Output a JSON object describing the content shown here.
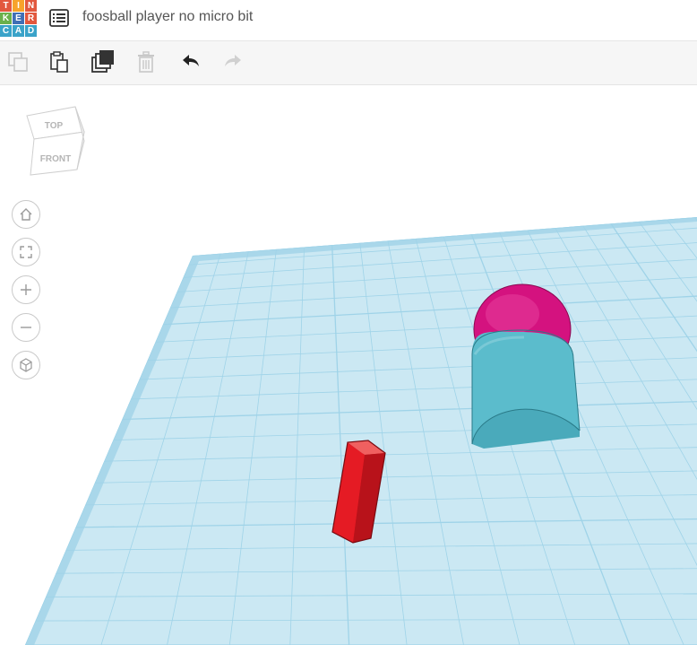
{
  "header": {
    "logo_letters": [
      "T",
      "I",
      "N",
      "K",
      "E",
      "R",
      "C",
      "A",
      "D"
    ],
    "logo_colors": [
      "#e2583e",
      "#f7a32b",
      "#e2583e",
      "#6ab04c",
      "#3f6fb5",
      "#e2583e",
      "#3aa3c9",
      "#3aa3c9",
      "#3aa3c9"
    ],
    "menu_icon": "list-icon",
    "title": "foosball player no micro bit"
  },
  "toolbar": {
    "copy_icon": "copy-icon",
    "paste_icon": "paste-icon",
    "duplicate_icon": "duplicate-icon",
    "delete_icon": "trash-icon",
    "undo_icon": "undo-icon",
    "redo_icon": "redo-icon"
  },
  "view_cube": {
    "top_label": "TOP",
    "front_label": "FRONT"
  },
  "nav_controls": [
    "home-icon",
    "fit-view-icon",
    "zoom-in-icon",
    "zoom-out-icon",
    "perspective-icon"
  ],
  "scene": {
    "workplane_color": "#cbe8f3",
    "grid_line_color": "#9fd3e8",
    "shapes": [
      {
        "name": "sphere",
        "color": "#d4127f"
      },
      {
        "name": "half-cylinder",
        "color": "#5bbccc"
      },
      {
        "name": "box",
        "color": "#e51b24"
      }
    ]
  }
}
